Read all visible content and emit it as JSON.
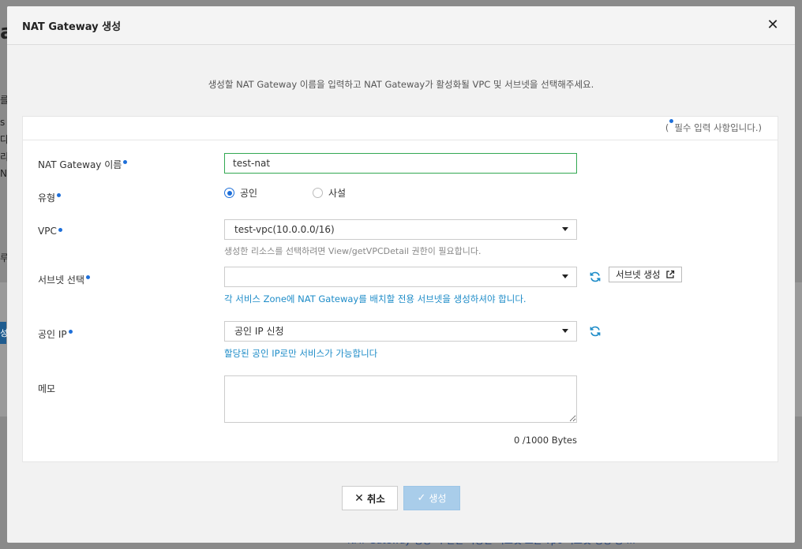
{
  "background": {
    "fragments": [
      "a",
      "를",
      "s",
      "다",
      "리",
      "N",
      "루",
      "성"
    ],
    "bottom_text": "NAT Gateway 생성 시 연결 가능한 서브넷 모든 vpc 서브넷 생성 중 ..."
  },
  "modal": {
    "title": "NAT Gateway 생성",
    "close_symbol": "✕",
    "intro": "생성할 NAT Gateway 이름을 입력하고 NAT Gateway가 활성화될 VPC 및 서브넷을 선택해주세요.",
    "required_note_open": "(",
    "required_note_text": "필수 입력 사항입니다.)"
  },
  "form": {
    "name": {
      "label": "NAT Gateway 이름",
      "value": "test-nat"
    },
    "type": {
      "label": "유형",
      "options": [
        "공인",
        "사설"
      ],
      "selected": "공인"
    },
    "vpc": {
      "label": "VPC",
      "value": "test-vpc(10.0.0.0/16)",
      "hint": "생성한 리소스를 선택하려면 View/getVPCDetail 권한이 필요합니다."
    },
    "subnet": {
      "label": "서브넷 선택",
      "value": "",
      "create_button": "서브넷 생성",
      "hint": "각 서비스 Zone에 NAT Gateway를 배치할 전용 서브넷을 생성하셔야 합니다."
    },
    "public_ip": {
      "label": "공인 IP",
      "value": "공인 IP 신청",
      "hint": "할당된 공인 IP로만 서비스가 가능합니다"
    },
    "memo": {
      "label": "메모",
      "value": "",
      "byte_count": "0 /1000 Bytes"
    }
  },
  "footer": {
    "cancel_label": "취소",
    "create_label": "생성"
  },
  "colors": {
    "accent": "#1e6fd9",
    "hint_blue": "#1e8cc8",
    "focus_green": "#32a852",
    "disabled_button": "#a9cdea"
  }
}
